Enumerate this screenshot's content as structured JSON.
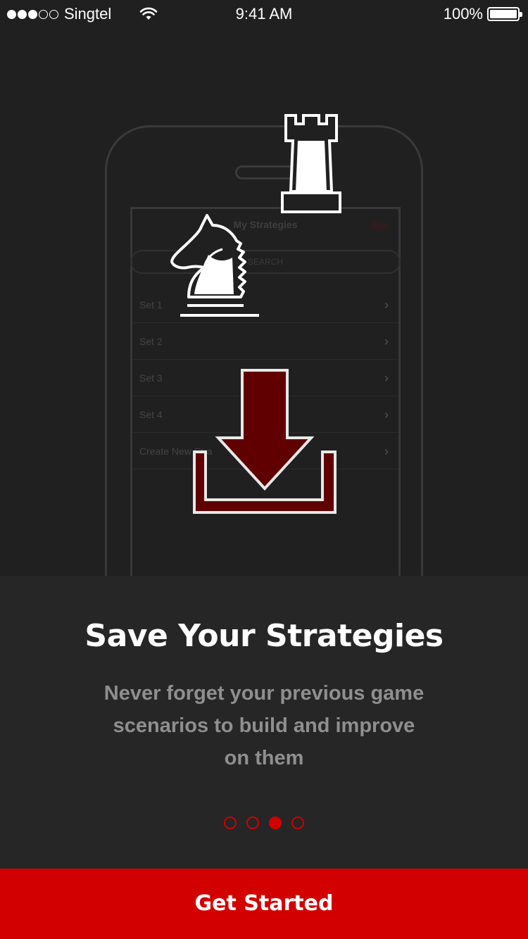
{
  "status_bar": {
    "carrier": "Singtel",
    "time": "9:41 AM",
    "battery": "100%",
    "signal_bars": 3,
    "signal_total": 5
  },
  "illustration": {
    "screen_title": "My Strategies",
    "screen_edit": "Edit",
    "screen_search_placeholder": "SEARCH",
    "rows": [
      {
        "label": "Set 1"
      },
      {
        "label": "Set 2"
      },
      {
        "label": "Set 3"
      },
      {
        "label": "Set 4"
      },
      {
        "label": "Create New Stra"
      }
    ],
    "icons": [
      "rook-icon",
      "knight-icon",
      "download-icon"
    ]
  },
  "onboarding": {
    "title": "Save Your Strategies",
    "description": "Never forget your previous game scenarios to build and improve on them",
    "page_count": 4,
    "current_page": 3
  },
  "cta": {
    "label": "Get Started"
  },
  "colors": {
    "background": "#202020",
    "panel": "#262626",
    "accent": "#d30000",
    "icon_fill_dark": "#600000"
  }
}
